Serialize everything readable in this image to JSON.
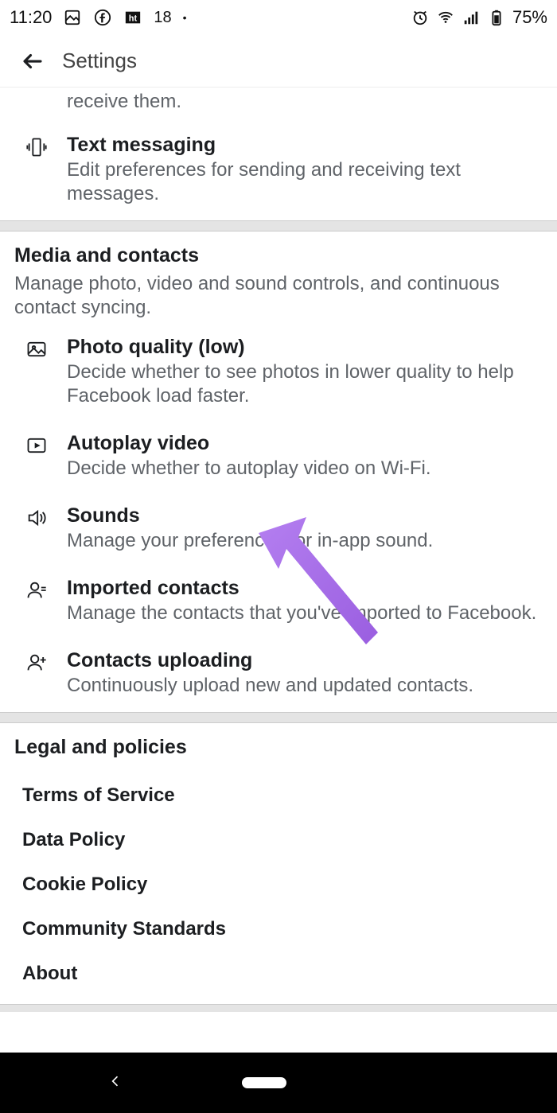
{
  "status": {
    "time": "11:20",
    "indicator_number": "18",
    "battery": "75%"
  },
  "appbar": {
    "title": "Settings"
  },
  "partial_item": {
    "desc": "receive them."
  },
  "text_messaging": {
    "title": "Text messaging",
    "desc": "Edit preferences for sending and receiving text messages."
  },
  "media_section": {
    "title": "Media and contacts",
    "desc": "Manage photo, video and sound controls, and continuous contact syncing."
  },
  "photo_quality": {
    "title": "Photo quality (low)",
    "desc": "Decide whether to see photos in lower quality to help Facebook load faster."
  },
  "autoplay": {
    "title": "Autoplay video",
    "desc": "Decide whether to autoplay video on Wi-Fi."
  },
  "sounds": {
    "title": "Sounds",
    "desc": "Manage your preferences for in-app sound."
  },
  "imported_contacts": {
    "title": "Imported contacts",
    "desc": "Manage the contacts that you've imported to Facebook."
  },
  "contacts_uploading": {
    "title": "Contacts uploading",
    "desc": "Continuously upload new and updated contacts."
  },
  "legal_section": {
    "title": "Legal and policies"
  },
  "legal": {
    "terms": "Terms of Service",
    "data_policy": "Data Policy",
    "cookie_policy": "Cookie Policy",
    "community": "Community Standards",
    "about": "About"
  }
}
